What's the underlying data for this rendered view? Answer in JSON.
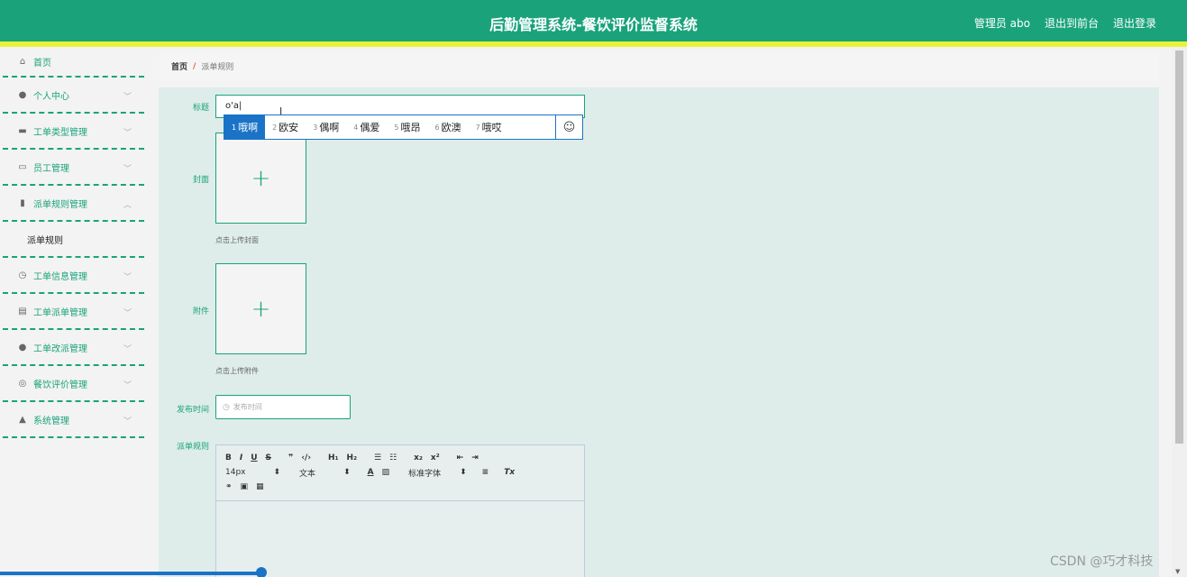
{
  "header": {
    "title": "后勤管理系统-餐饮评价监督系统",
    "user": "管理员 abo",
    "front_link": "退出到前台",
    "logout": "退出登录"
  },
  "sidebar": {
    "items": [
      {
        "label": "首页",
        "icon": "home-icon"
      },
      {
        "label": "个人中心",
        "icon": "user-icon"
      },
      {
        "label": "工单类型管理",
        "icon": "monitor-icon"
      },
      {
        "label": "员工管理",
        "icon": "chat-icon"
      },
      {
        "label": "派单规则管理",
        "icon": "chart-icon"
      },
      {
        "label": "派单规则",
        "sub": true
      },
      {
        "label": "工单信息管理",
        "icon": "clock-icon"
      },
      {
        "label": "工单派单管理",
        "icon": "clipboard-icon"
      },
      {
        "label": "工单改派管理",
        "icon": "pin-icon"
      },
      {
        "label": "餐饮评价管理",
        "icon": "compass-icon"
      },
      {
        "label": "系统管理",
        "icon": "person-icon"
      }
    ]
  },
  "breadcrumb": {
    "home": "首页",
    "separator": "/",
    "current": "派单规则"
  },
  "form": {
    "title_label": "标题",
    "title_value": "o'a|",
    "cover_label": "封面",
    "cover_hint": "点击上传封面",
    "attachment_label": "附件",
    "attachment_hint": "点击上传附件",
    "publish_label": "发布时间",
    "publish_placeholder": "发布时间",
    "rules_label": "派单规则"
  },
  "editor": {
    "font_size": "14px",
    "text_type": "文本",
    "font_family": "标准字体"
  },
  "ime": {
    "candidates": [
      {
        "num": "1",
        "text": "哦啊"
      },
      {
        "num": "2",
        "text": "欧安"
      },
      {
        "num": "3",
        "text": "偶啊"
      },
      {
        "num": "4",
        "text": "偶爱"
      },
      {
        "num": "5",
        "text": "哦昂"
      },
      {
        "num": "6",
        "text": "欧澳"
      },
      {
        "num": "7",
        "text": "哦哎"
      }
    ]
  },
  "watermark": "CSDN @巧才科技",
  "colors": {
    "primary": "#1aa37a",
    "stripe": "#e9f23b",
    "ime": "#1a73c7"
  }
}
